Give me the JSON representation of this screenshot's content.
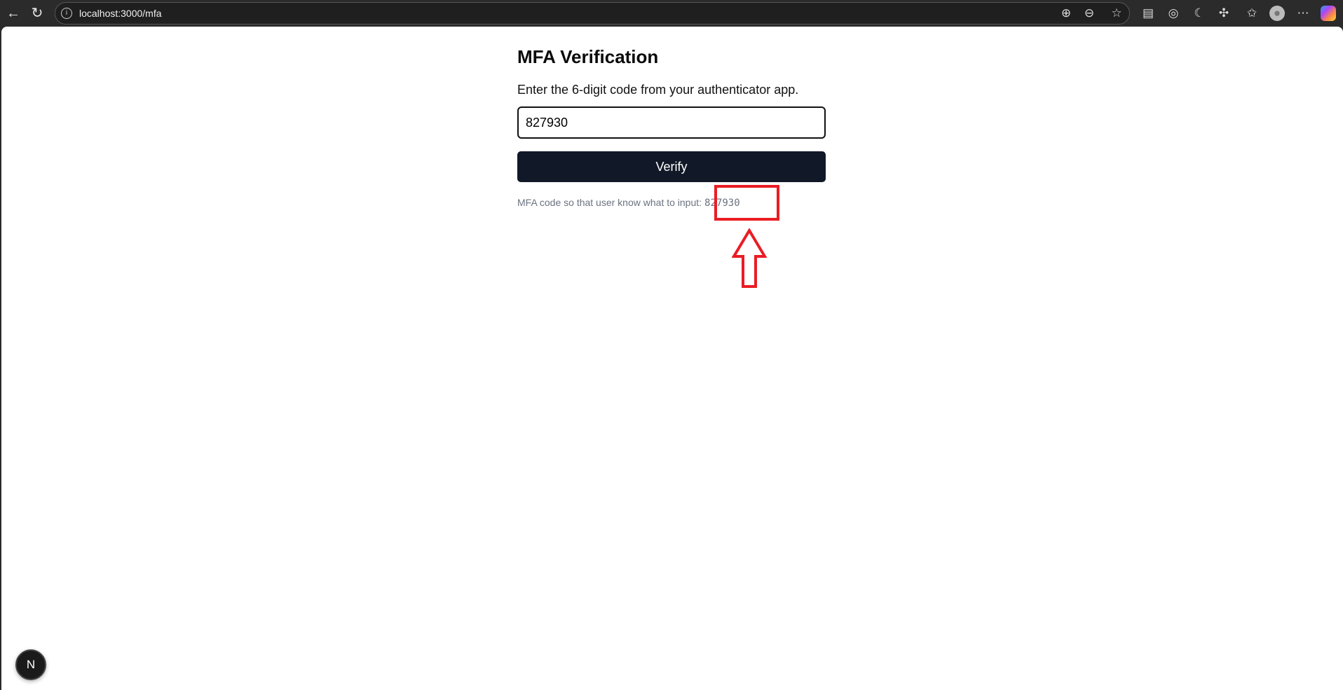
{
  "browser": {
    "url": "localhost:3000/mfa"
  },
  "page": {
    "title": "MFA Verification",
    "description": "Enter the 6-digit code from your authenticator app.",
    "code_value": "827930",
    "verify_label": "Verify",
    "hint_text": "MFA code so that user know what to input:",
    "hint_code": "827930"
  },
  "dev_badge": "N",
  "colors": {
    "button": "#111827",
    "annotation": "#ea1c24"
  }
}
